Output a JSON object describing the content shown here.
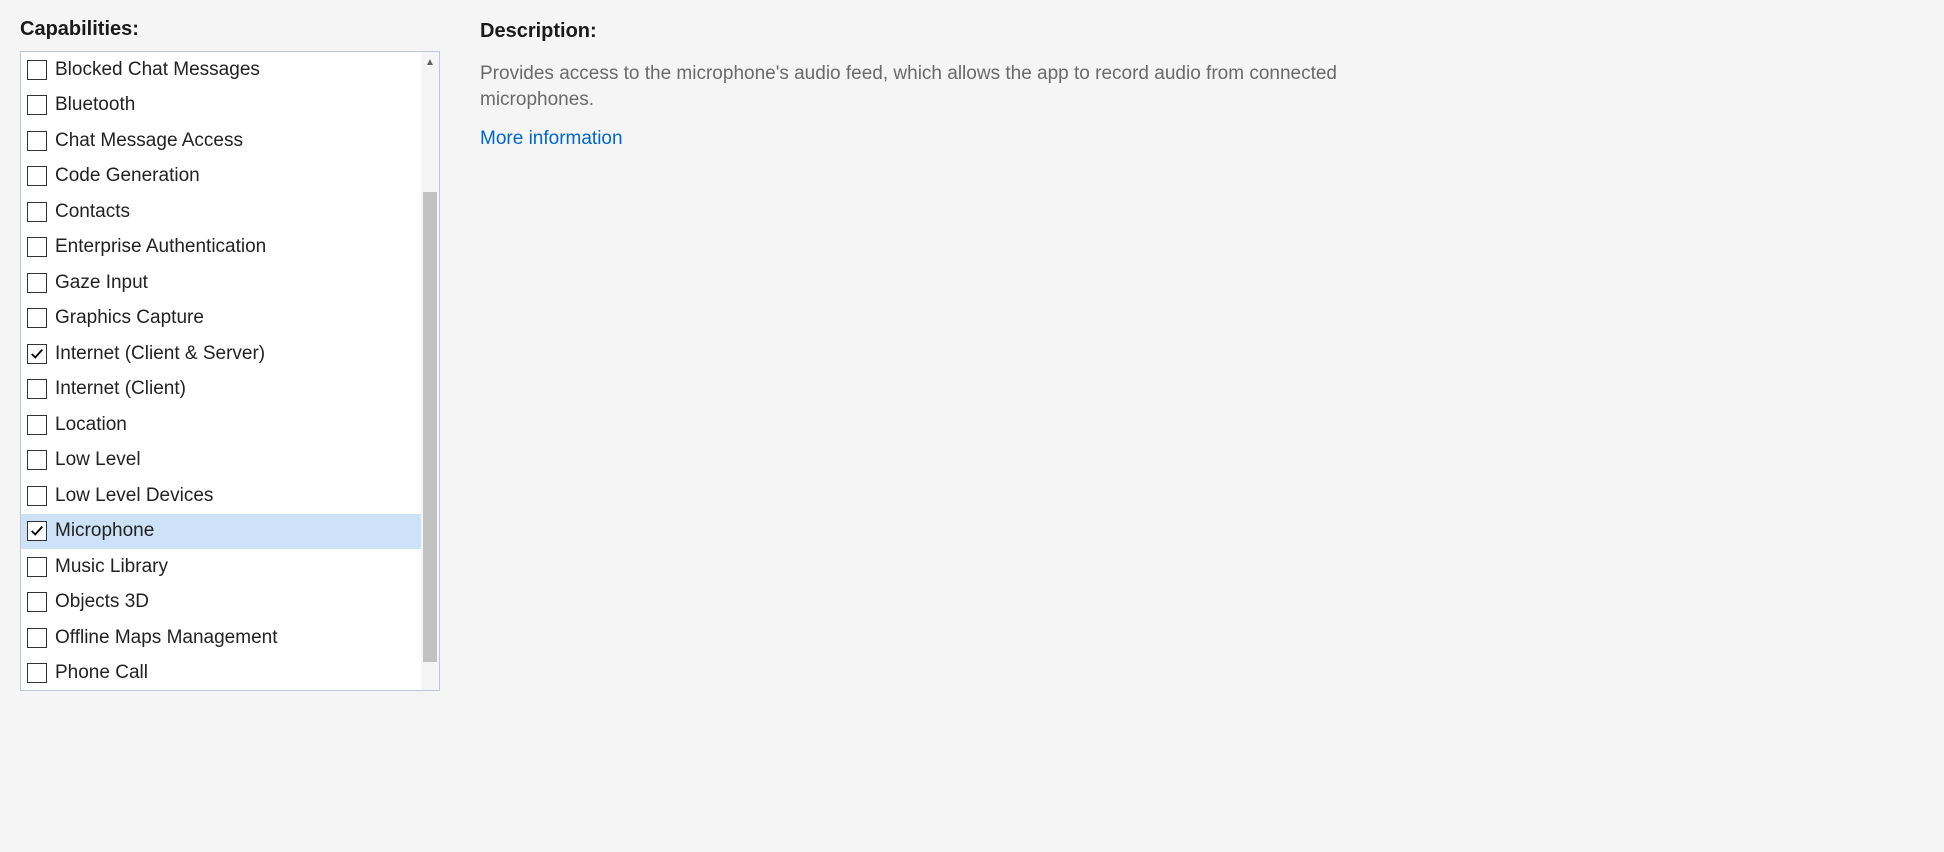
{
  "left": {
    "heading": "Capabilities:",
    "items": [
      {
        "label": "Blocked Chat Messages",
        "checked": false,
        "selected": false
      },
      {
        "label": "Bluetooth",
        "checked": false,
        "selected": false
      },
      {
        "label": "Chat Message Access",
        "checked": false,
        "selected": false
      },
      {
        "label": "Code Generation",
        "checked": false,
        "selected": false
      },
      {
        "label": "Contacts",
        "checked": false,
        "selected": false
      },
      {
        "label": "Enterprise Authentication",
        "checked": false,
        "selected": false
      },
      {
        "label": "Gaze Input",
        "checked": false,
        "selected": false
      },
      {
        "label": "Graphics Capture",
        "checked": false,
        "selected": false
      },
      {
        "label": "Internet (Client & Server)",
        "checked": true,
        "selected": false
      },
      {
        "label": "Internet (Client)",
        "checked": false,
        "selected": false
      },
      {
        "label": "Location",
        "checked": false,
        "selected": false
      },
      {
        "label": "Low Level",
        "checked": false,
        "selected": false
      },
      {
        "label": "Low Level Devices",
        "checked": false,
        "selected": false
      },
      {
        "label": "Microphone",
        "checked": true,
        "selected": true
      },
      {
        "label": "Music Library",
        "checked": false,
        "selected": false
      },
      {
        "label": "Objects 3D",
        "checked": false,
        "selected": false
      },
      {
        "label": "Offline Maps Management",
        "checked": false,
        "selected": false
      },
      {
        "label": "Phone Call",
        "checked": false,
        "selected": false
      }
    ]
  },
  "right": {
    "heading": "Description:",
    "description": "Provides access to the microphone's audio feed, which allows the app to record audio from connected microphones.",
    "link_label": "More information"
  }
}
